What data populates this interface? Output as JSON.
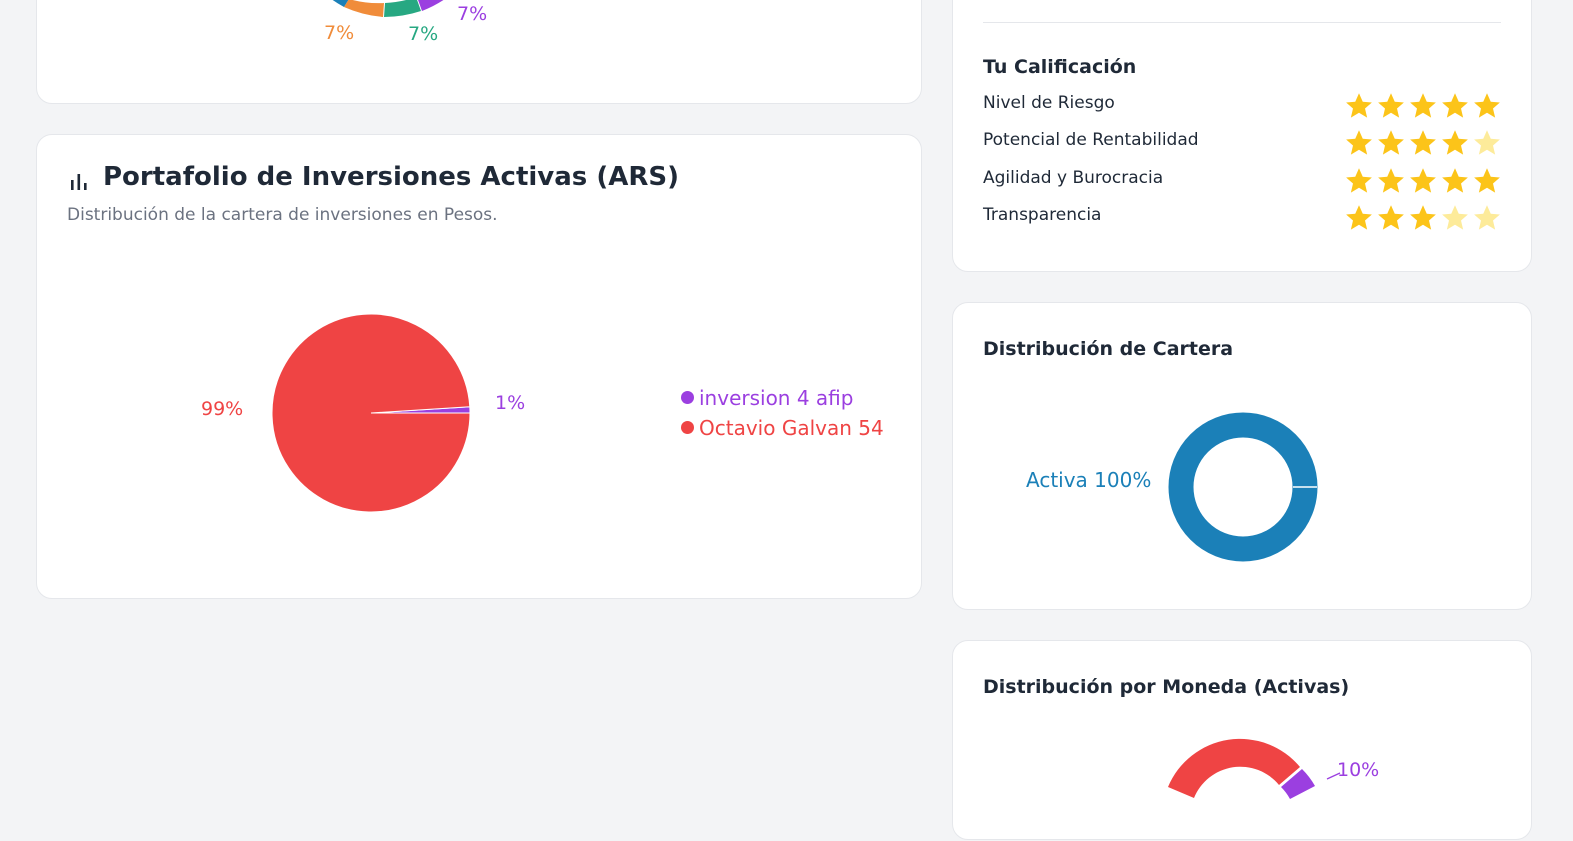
{
  "colors": {
    "purple": "#9b3fe0",
    "red": "#ef4444",
    "orange": "#f08c3a",
    "green": "#27a882",
    "blue": "#1b80b8",
    "star_on": "#fcc419",
    "star_off": "#fdeb9a"
  },
  "top_chart": {
    "labels": [
      "7%",
      "7%",
      "7%"
    ]
  },
  "ars_portfolio": {
    "icon": "bar-chart-icon",
    "title": "Portafolio de Inversiones Activas (ARS)",
    "subtitle": "Distribución de la cartera de inversiones en Pesos.",
    "legend": [
      "inversion 4 afip",
      "Octavio Galvan 54"
    ]
  },
  "chart_data": [
    {
      "type": "pie",
      "title": "Portafolio de Inversiones Activas (ARS)",
      "categories": [
        "inversion 4 afip",
        "Octavio Galvan 54"
      ],
      "values": [
        1,
        99
      ],
      "labels": [
        "1%",
        "99%"
      ],
      "legend": "right"
    },
    {
      "type": "pie",
      "title": "Distribución de Cartera",
      "categories": [
        "Activa"
      ],
      "values": [
        100
      ],
      "labels": [
        "Activa 100%"
      ]
    }
  ],
  "rating": {
    "title": "Tu Calificación",
    "items": [
      {
        "label": "Nivel de Riesgo",
        "stars": 5
      },
      {
        "label": "Potencial de Rentabilidad",
        "stars": 4
      },
      {
        "label": "Agilidad y Burocracia",
        "stars": 5
      },
      {
        "label": "Transparencia",
        "stars": 3
      }
    ],
    "max_stars": 5
  },
  "cartera": {
    "title": "Distribución de Cartera",
    "label": "Activa 100%"
  },
  "moneda": {
    "title": "Distribución por Moneda (Activas)",
    "label": "10%"
  }
}
